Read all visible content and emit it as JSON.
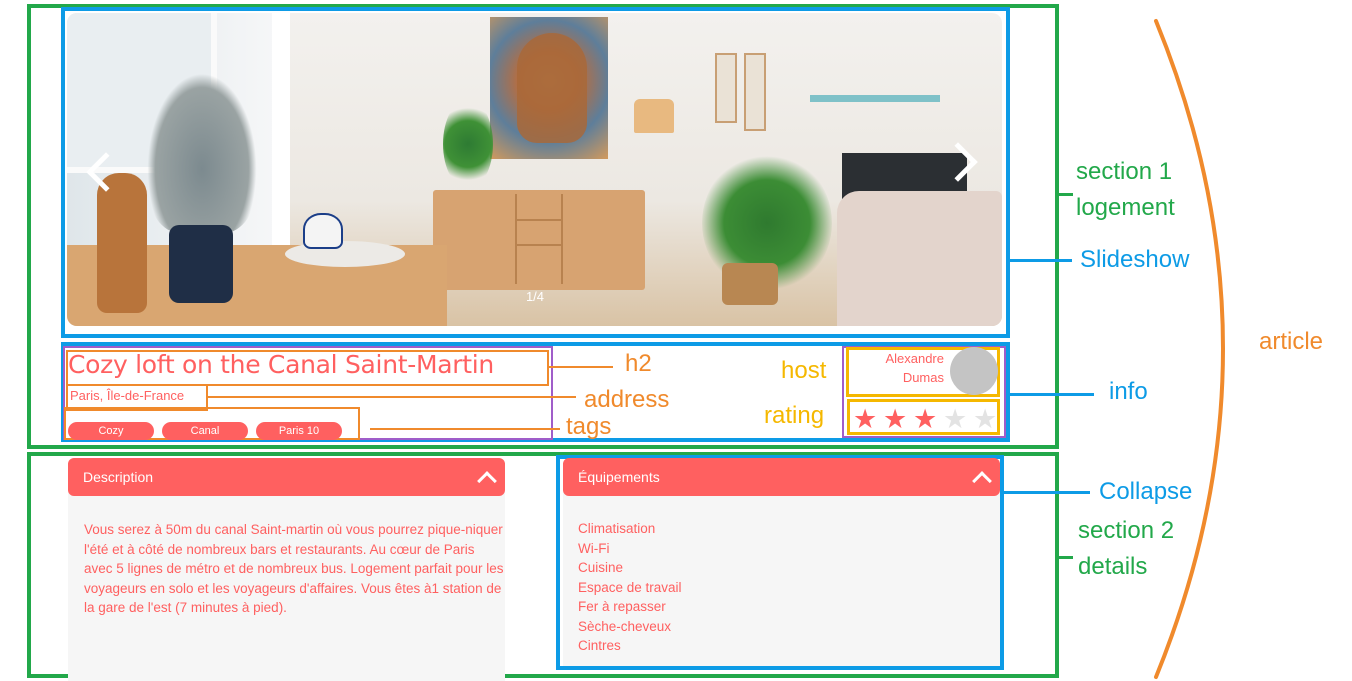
{
  "listing": {
    "title": "Cozy loft on the Canal Saint-Martin",
    "address": "Paris, Île-de-France",
    "tags": [
      "Cozy",
      "Canal",
      "Paris 10"
    ],
    "host": {
      "name": "Alexandre Dumas"
    },
    "rating": {
      "value": 3,
      "max": 5
    },
    "slideshow": {
      "counter": "1/4"
    }
  },
  "description": {
    "title": "Description",
    "text": "Vous serez à 50m du canal Saint-martin où vous pourrez pique-niquer l'été et à côté de nombreux bars et restaurants. Au cœur de Paris avec 5 lignes de métro et de nombreux bus. Logement parfait pour les voyageurs en solo et les voyageurs d'affaires. Vous êtes à1 station de la gare de l'est (7 minutes à pied)."
  },
  "equipments": {
    "title": "Équipements",
    "items": [
      "Climatisation",
      "Wi-Fi",
      "Cuisine",
      "Espace de travail",
      "Fer à repasser",
      "Sèche-cheveux",
      "Cintres"
    ]
  },
  "annotations": {
    "h2": "h2",
    "address": "address",
    "tags": "tags",
    "host": "host",
    "rating": "rating",
    "info": "info",
    "slideshow": "Slideshow",
    "collapse": "Collapse",
    "section1": [
      "section 1",
      "logement"
    ],
    "section2": [
      "section 2",
      "details"
    ],
    "article": "article"
  },
  "colors": {
    "brand": "#ff6060",
    "section_outline": "#22a84a",
    "component_outline": "#0d9be6",
    "element_outline": "#f08a2c",
    "host_rating_outline": "#f5b800",
    "info_outline": "#a05dc9"
  }
}
